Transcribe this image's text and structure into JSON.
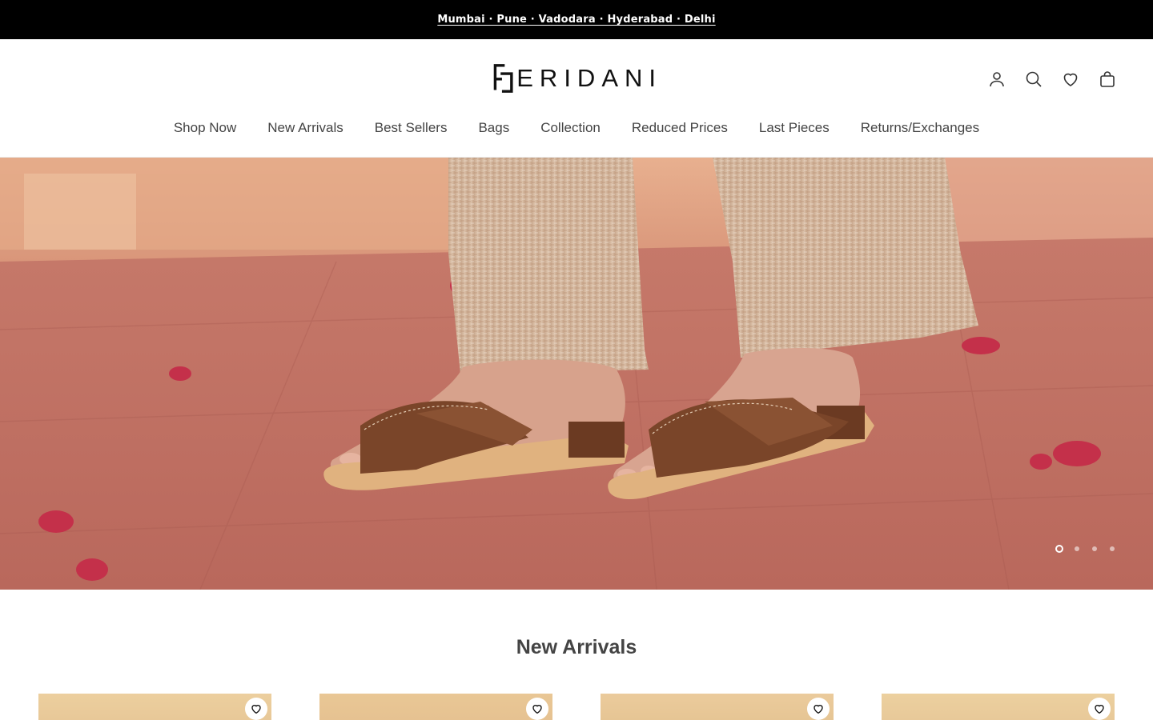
{
  "announcement": {
    "text": "Mumbai · Pune · Vadodara · Hyderabad · Delhi"
  },
  "brand": {
    "name": "ERIDANI"
  },
  "header_icons": [
    {
      "name": "account",
      "icon": "user-icon"
    },
    {
      "name": "search",
      "icon": "search-icon"
    },
    {
      "name": "wishlist",
      "icon": "heart-icon"
    },
    {
      "name": "cart",
      "icon": "bag-icon"
    }
  ],
  "nav": [
    {
      "label": "Shop Now"
    },
    {
      "label": "New Arrivals"
    },
    {
      "label": "Best Sellers"
    },
    {
      "label": "Bags"
    },
    {
      "label": "Collection"
    },
    {
      "label": "Reduced Prices"
    },
    {
      "label": "Last Pieces"
    },
    {
      "label": "Returns/Exchanges"
    }
  ],
  "hero": {
    "slide_count": 4,
    "active_slide": 1,
    "image": "model wearing brown criss-cross leather slide sandals on terracotta floor with pink bougainvillea petals"
  },
  "new_arrivals": {
    "title": "New Arrivals",
    "cards": [
      {
        "wishlist_icon": "heart-icon"
      },
      {
        "wishlist_icon": "heart-icon"
      },
      {
        "wishlist_icon": "heart-icon"
      },
      {
        "wishlist_icon": "heart-icon"
      }
    ]
  },
  "colors": {
    "announcement_bg": "#000000",
    "text": "#444444",
    "hero_floor": "#c8786a",
    "sandal": "#7a4529"
  }
}
